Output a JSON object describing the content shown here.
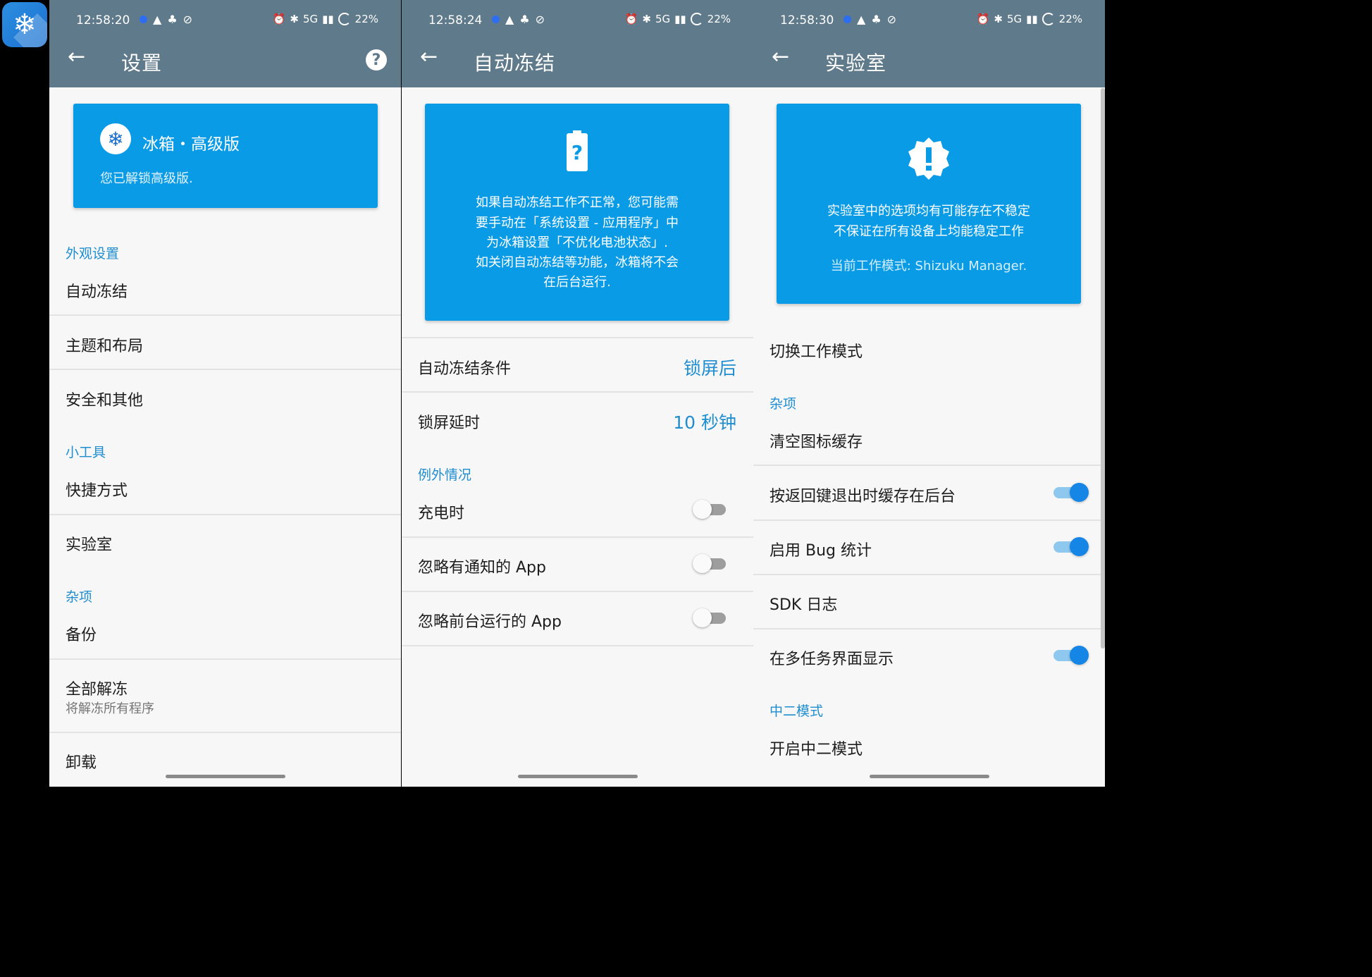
{
  "launcher": {
    "icon": "snowflake-icon"
  },
  "status_bars": [
    {
      "time": "12:58:20",
      "battery": "22%",
      "network": "5G"
    },
    {
      "time": "12:58:24",
      "battery": "22%",
      "network": "5G"
    },
    {
      "time": "12:58:30",
      "battery": "22%",
      "network": "5G"
    }
  ],
  "panel1": {
    "title": "设置",
    "card": {
      "title": "冰箱・高级版",
      "subtitle": "您已解锁高级版."
    },
    "sec_appearance": "外观设置",
    "item_autofreeze": "自动冻结",
    "item_theme": "主题和布局",
    "item_security": "安全和其他",
    "sec_tools": "小工具",
    "item_shortcut": "快捷方式",
    "item_lab": "实验室",
    "sec_misc": "杂项",
    "item_backup": "备份",
    "item_unfreeze_all": "全部解冻",
    "item_unfreeze_all_sub": "将解冻所有程序",
    "item_uninstall": "卸载"
  },
  "panel2": {
    "title": "自动冻结",
    "card": {
      "line1": "如果自动冻结工作不正常，您可能需",
      "line2": "要手动在「系统设置 - 应用程序」中",
      "line3": "为冰箱设置「不优化电池状态」.",
      "line4": "如关闭自动冻结等功能，冰箱将不会",
      "line5": "在后台运行."
    },
    "row_condition": {
      "label": "自动冻结条件",
      "value": "锁屏后"
    },
    "row_delay": {
      "label": "锁屏延时",
      "value": "10 秒钟"
    },
    "sec_exceptions": "例外情况",
    "toggle_charging": {
      "label": "充电时",
      "on": false
    },
    "toggle_notif": {
      "label": "忽略有通知的 App",
      "on": false
    },
    "toggle_foreground": {
      "label": "忽略前台运行的 App",
      "on": false
    }
  },
  "panel3": {
    "title": "实验室",
    "card": {
      "line1": "实验室中的选项均有可能存在不稳定",
      "line2": "不保证在所有设备上均能稳定工作",
      "mode": "当前工作模式: Shizuku Manager."
    },
    "item_switch_mode": "切换工作模式",
    "sec_misc": "杂项",
    "item_clear_cache": "清空图标缓存",
    "toggle_back_cache": {
      "label": "按返回键退出时缓存在后台",
      "on": true
    },
    "toggle_bug": {
      "label": "启用 Bug 统计",
      "on": true
    },
    "item_sdk_log": "SDK 日志",
    "toggle_recents": {
      "label": "在多任务界面显示",
      "on": true
    },
    "sec_chuuni": "中二模式",
    "item_chuuni": "开启中二模式"
  }
}
